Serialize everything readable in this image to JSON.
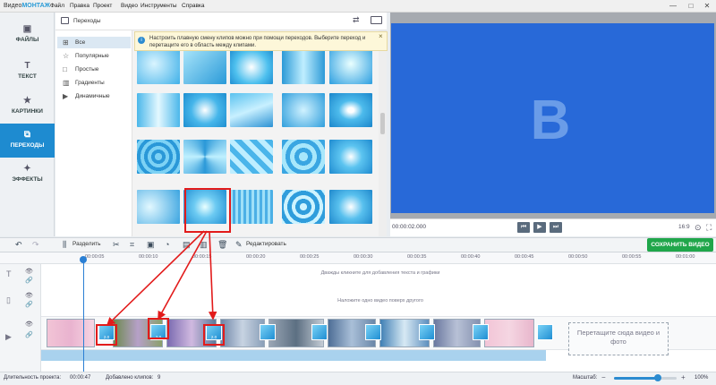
{
  "app": {
    "title_prefix": "Видео",
    "title_brand": "МОНТАЖ"
  },
  "menu": [
    "Файл",
    "Правка",
    "Проект",
    "Видео",
    "Инструменты",
    "Справка"
  ],
  "window_controls": [
    "—",
    "□",
    "✕"
  ],
  "sidebar": {
    "items": [
      {
        "label": "ФАЙЛЫ",
        "icon": "image-icon",
        "glyph": "▣"
      },
      {
        "label": "ТЕКСТ",
        "icon": "text-icon",
        "glyph": "T"
      },
      {
        "label": "КАРТИНКИ",
        "icon": "star-icon",
        "glyph": "★"
      },
      {
        "label": "ПЕРЕХОДЫ",
        "icon": "transitions-icon",
        "glyph": "⧉",
        "active": true
      },
      {
        "label": "ЭФФЕКТЫ",
        "icon": "effects-icon",
        "glyph": "✦"
      }
    ]
  },
  "panel": {
    "title": "Переходы",
    "shuffle_icon": "shuffle-icon",
    "sound_icon": "audio-icon"
  },
  "categories": [
    {
      "label": "Все",
      "icon": "grid-icon",
      "glyph": "⊞",
      "active": true
    },
    {
      "label": "Популярные",
      "icon": "star-outline-icon",
      "glyph": "☆"
    },
    {
      "label": "Простые",
      "icon": "square-icon",
      "glyph": "□"
    },
    {
      "label": "Градиенты",
      "icon": "gradient-icon",
      "glyph": "▥"
    },
    {
      "label": "Динамичные",
      "icon": "play-icon",
      "glyph": "▶"
    }
  ],
  "tip": {
    "text": "Настроить плавную смену клипов можно при помощи переходов. Выберите переход и перетащите его в область между клипами.",
    "close": "×"
  },
  "preview": {
    "letter": "B",
    "time": "00:00:02.000",
    "aspect": "16:9"
  },
  "player_buttons": [
    "⏮",
    "▶",
    "⏭"
  ],
  "toolbar": {
    "split_label": "Разделить",
    "edit_label": "Редактировать",
    "save_label": "СОХРАНИТЬ ВИДЕО"
  },
  "ruler_ticks": [
    "00:00:05",
    "00:00:10",
    "00:00:15",
    "00:00:20",
    "00:00:25",
    "00:00:30",
    "00:00:35",
    "00:00:40",
    "00:00:45",
    "00:00:50",
    "00:00:55",
    "00:01:00"
  ],
  "timeline": {
    "text_hint": "Дважды кликните для добавления текста и графики",
    "overlay_hint": "Наложите одно видео поверх другого",
    "transition_duration": "2.0",
    "drop_zone": "Перетащите сюда видео и фото"
  },
  "status": {
    "duration_label": "Длительность проекта:",
    "duration_value": "00:00:47",
    "clips_label": "Добавлено клипов:",
    "clips_value": "9",
    "scale_label": "Масштаб:",
    "zoom_percent": "100%",
    "zoom_level": 0.7
  },
  "colors": {
    "accent": "#1e8bd0",
    "save": "#1fa64a",
    "highlight": "#e21b1b",
    "preview_bg": "#2869d8"
  }
}
